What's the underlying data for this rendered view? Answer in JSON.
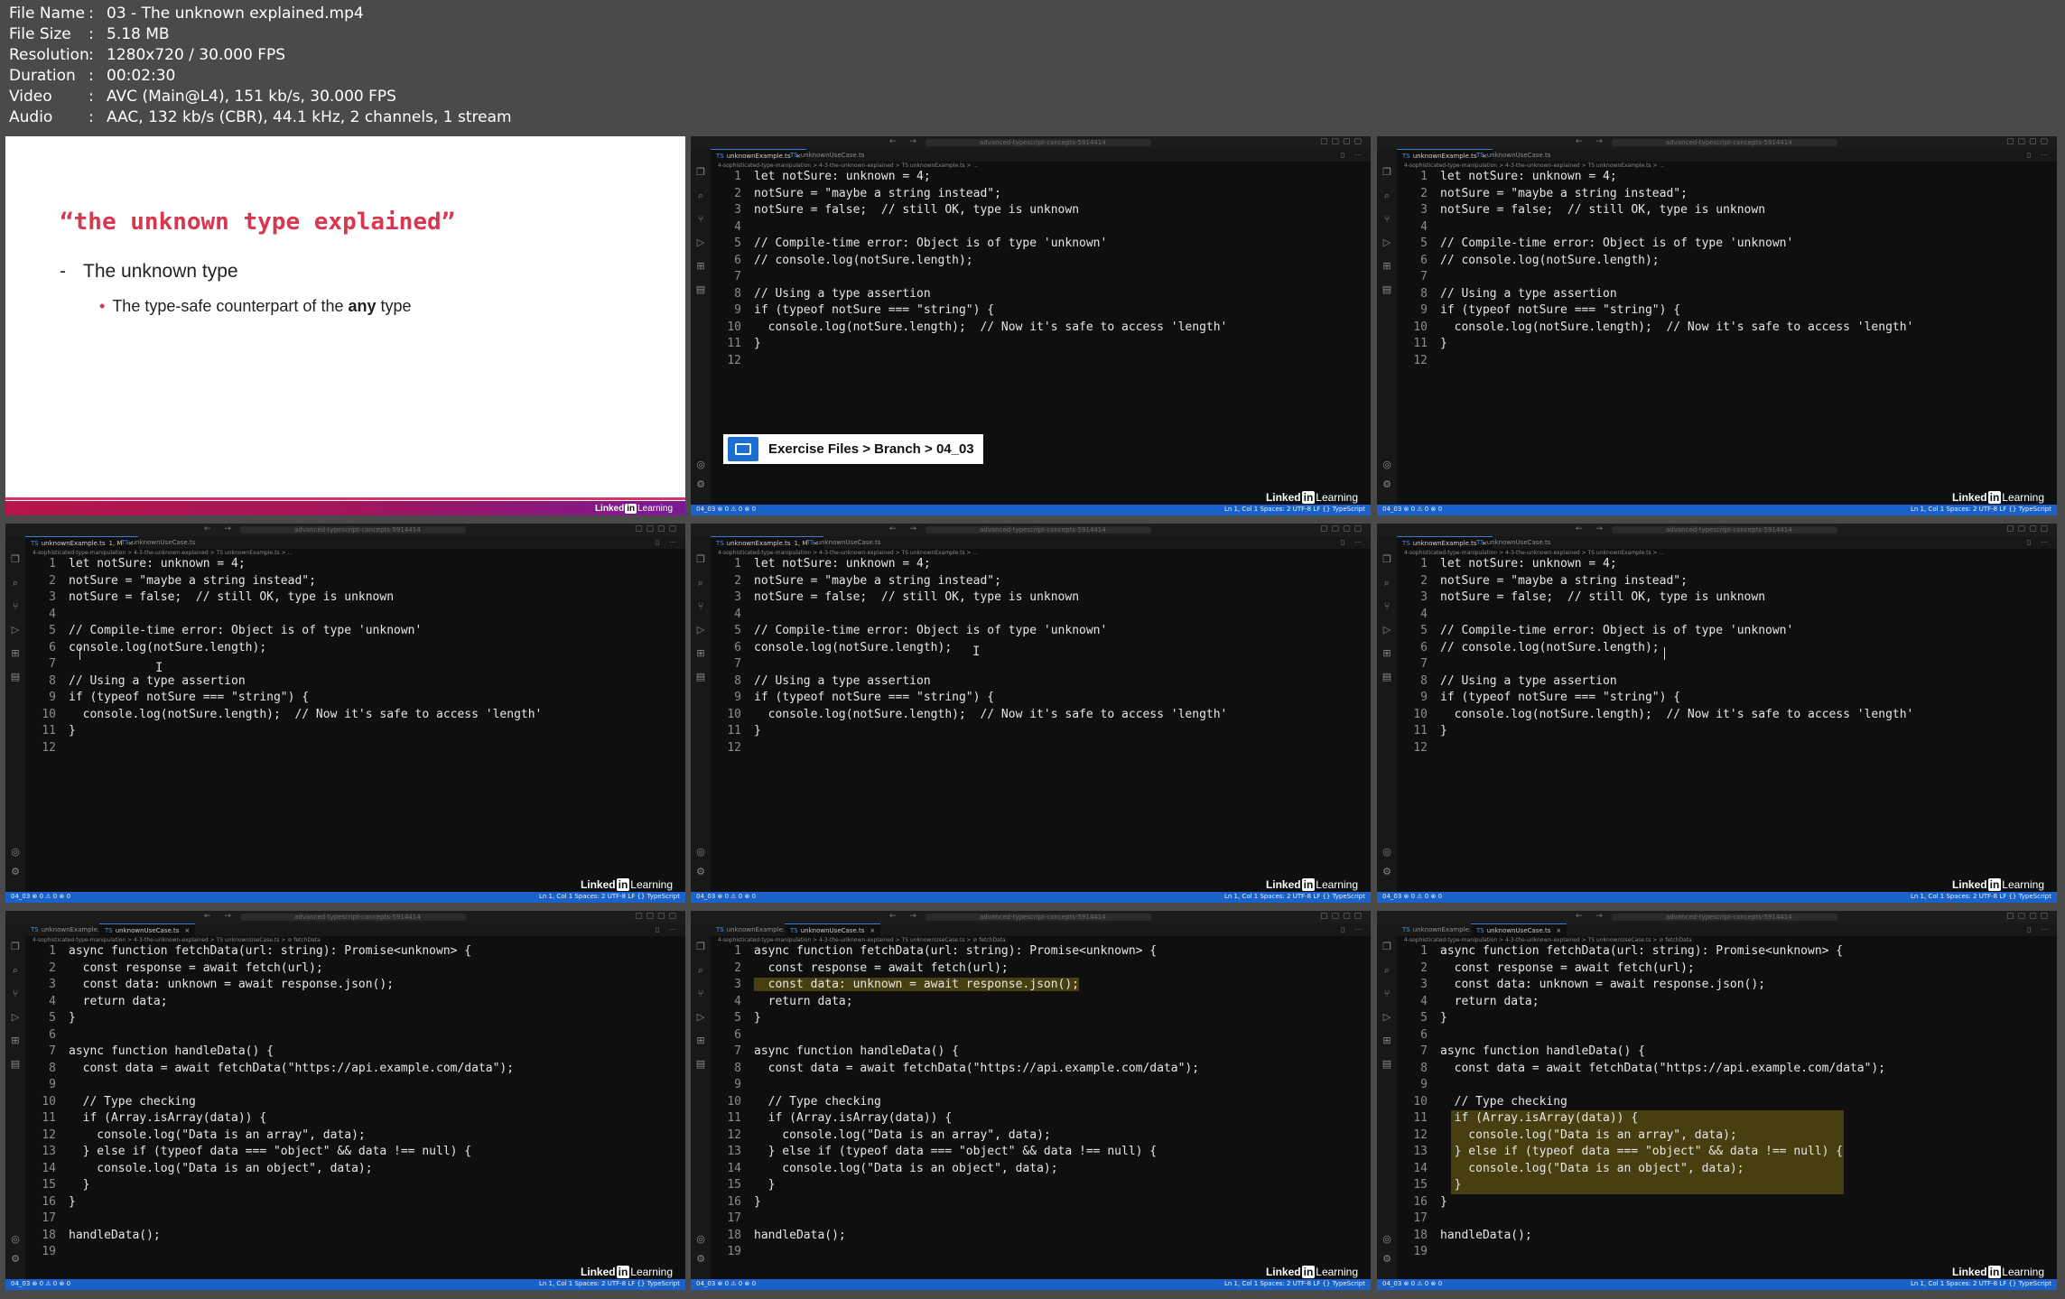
{
  "header": {
    "rows": [
      {
        "key": "File Name",
        "value": "03 - The unknown explained.mp4"
      },
      {
        "key": "File Size",
        "value": "5.18 MB"
      },
      {
        "key": "Resolution",
        "value": "1280x720 / 30.000 FPS"
      },
      {
        "key": "Duration",
        "value": "00:02:30"
      },
      {
        "key": "Video",
        "value": "AVC (Main@L4), 151 kb/s, 30.000 FPS"
      },
      {
        "key": "Audio",
        "value": "AAC, 132 kb/s (CBR), 44.1 kHz, 2 channels, 1 stream"
      }
    ]
  },
  "slide": {
    "title": "“the unknown type explained”",
    "bullet": "The unknown type",
    "sub_prefix": "The type-safe counterpart of the ",
    "sub_bold": "any",
    "sub_suffix": " type"
  },
  "editor": {
    "search_text": "advanced-typescript-concepts-5914414",
    "tab_example": "unknownExample.ts",
    "tab_usecase": "unknownUseCase.ts",
    "tab_modified_badge": "1, M",
    "breadcrumbs_example": "4-sophisticated-type-manipulation > 4-3-the-unknown-explained > TS unknownExample.ts > ...",
    "breadcrumbs_usecase": "4-sophisticated-type-manipulation > 4-3-the-unknown-explained > TS unknownUseCase.ts > ⊘ fetchData",
    "status_left": "04_03  ⊗ 0 ⚠ 0  ⊗ 0",
    "status_right": "Ln 1, Col 1   Spaces: 2   UTF-8   LF   {} TypeScript",
    "brand_a": "Linked",
    "brand_b": "in",
    "brand_c": "Learning",
    "callout": "Exercise Files > Branch > 04_03"
  },
  "code_example_commented": [
    "let notSure: unknown = 4;",
    "notSure = \"maybe a string instead\";",
    "notSure = false;  // still OK, type is unknown",
    "",
    "// Compile-time error: Object is of type 'unknown'",
    "// console.log(notSure.length);",
    "",
    "// Using a type assertion",
    "if (typeof notSure === \"string\") {",
    "  console.log(notSure.length);  // Now it's safe to access 'length'",
    "}",
    ""
  ],
  "code_example_uncommented": [
    "let notSure: unknown = 4;",
    "notSure = \"maybe a string instead\";",
    "notSure = false;  // still OK, type is unknown",
    "",
    "// Compile-time error: Object is of type 'unknown'",
    "console.log(notSure.length);",
    "",
    "// Using a type assertion",
    "if (typeof notSure === \"string\") {",
    "  console.log(notSure.length);  // Now it's safe to access 'length'",
    "}",
    ""
  ],
  "code_usecase": [
    "async function fetchData(url: string): Promise<unknown> {",
    "  const response = await fetch(url);",
    "  const data: unknown = await response.json();",
    "  return data;",
    "}",
    "",
    "async function handleData() {",
    "  const data = await fetchData(\"https://api.example.com/data\");",
    "",
    "  // Type checking",
    "  if (Array.isArray(data)) {",
    "    console.log(\"Data is an array\", data);",
    "  } else if (typeof data === \"object\" && data !== null) {",
    "    console.log(\"Data is an object\", data);",
    "  }",
    "}",
    "",
    "handleData();",
    ""
  ],
  "colors": {
    "slide_accent": "#d9364f",
    "statusbar": "#1a62c8",
    "editor_bg": "#0f0f0f",
    "highlight": "#6e6214"
  }
}
